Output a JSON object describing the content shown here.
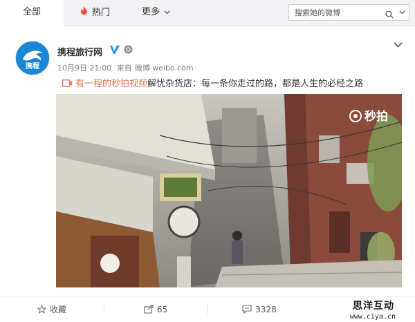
{
  "tabs": {
    "all": "全部",
    "hot": "热门",
    "more": "更多"
  },
  "search": {
    "placeholder": "搜索她的微博"
  },
  "post": {
    "author": "携程旅行网",
    "avatar_text": "携程",
    "date": "10月9日 21:00",
    "source_prefix": "来自",
    "source": "微博 weibo.com",
    "link_text": "有一程的秒拍视频",
    "body": "解忧杂货店：每一条你走过的路，都是人生的必经之路",
    "video_overlay": "秒拍"
  },
  "actions": {
    "favorite": "收藏",
    "forward": "65",
    "comment": "3328"
  },
  "watermark": {
    "cn": "思洋互动",
    "url": "www.ciya.cn"
  },
  "colors": {
    "link": "#eb7350",
    "verified": "#1a8ff0",
    "avatar_bg": "#1a86d6"
  }
}
